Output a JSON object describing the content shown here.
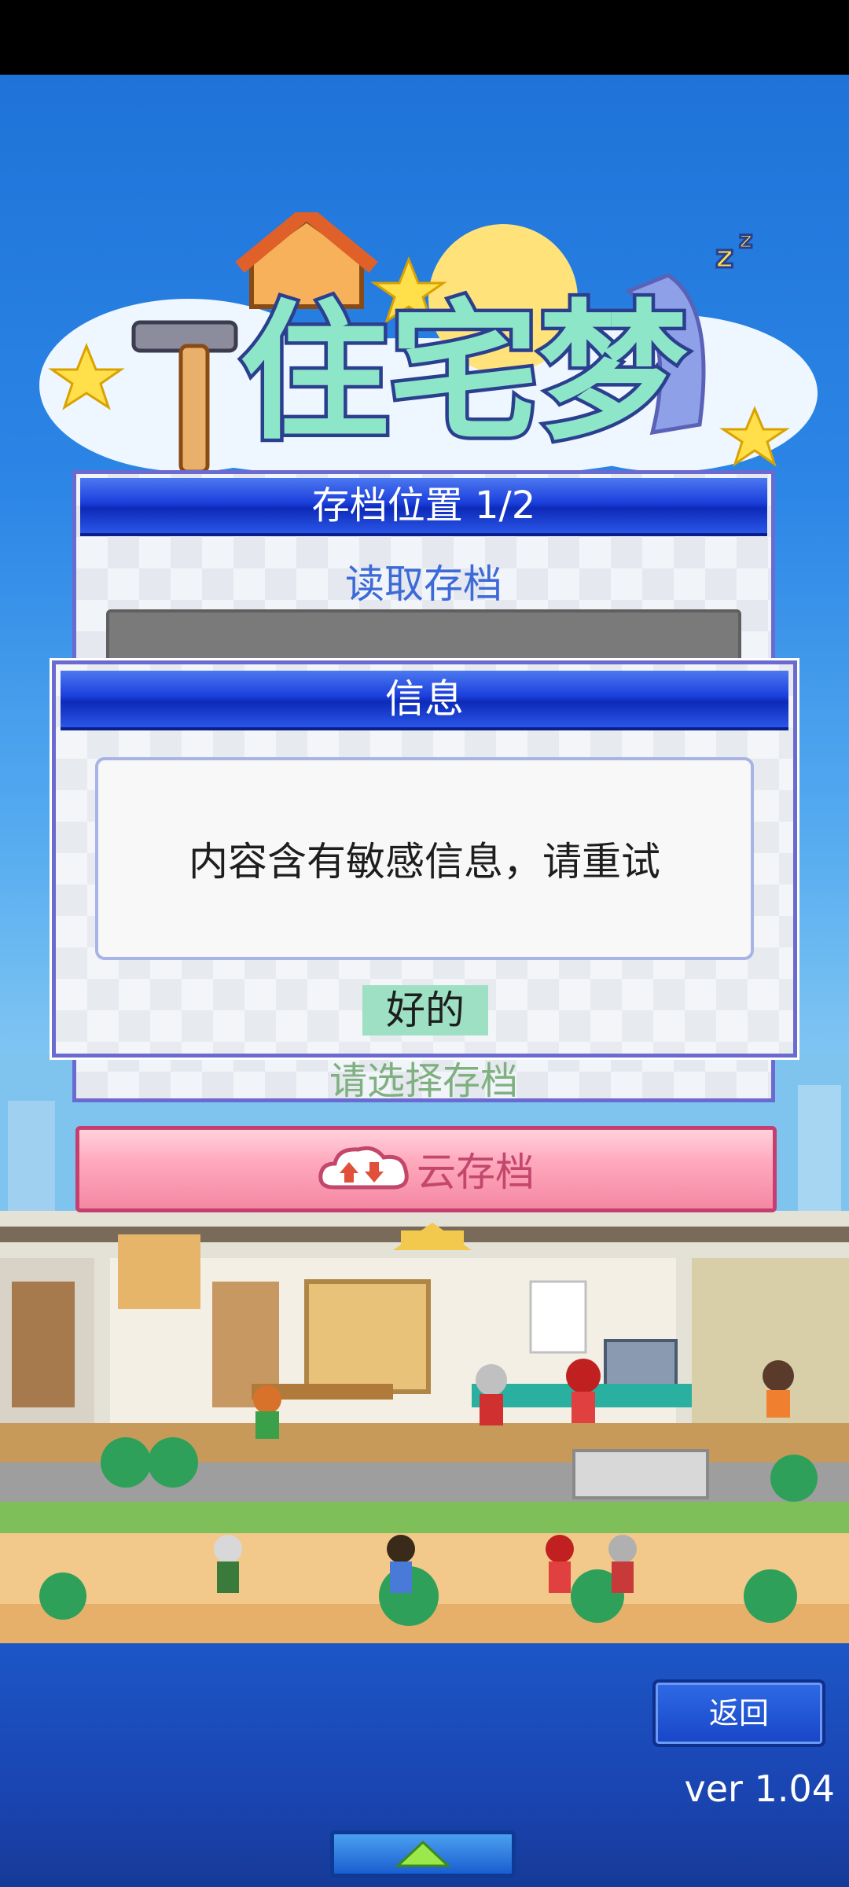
{
  "game": {
    "logo_text": "住宅梦",
    "save_panel": {
      "title": "存档位置 1/2",
      "load_label": "读取存档",
      "select_hint": "请选择存档"
    },
    "cloud_save": {
      "label": "云存档",
      "icon": "cloud-arrows-icon"
    },
    "dialog": {
      "title": "信息",
      "message": "内容含有敏感信息，请重试",
      "ok_label": "好的"
    },
    "back_label": "返回",
    "version": "ver 1.04",
    "up_icon": "up-arrow-icon"
  },
  "colors": {
    "title_bar": "#1b3fdc",
    "ok_button": "#9de0c4",
    "cloud_button": "#f488a3",
    "sky": "#2c86e6"
  }
}
